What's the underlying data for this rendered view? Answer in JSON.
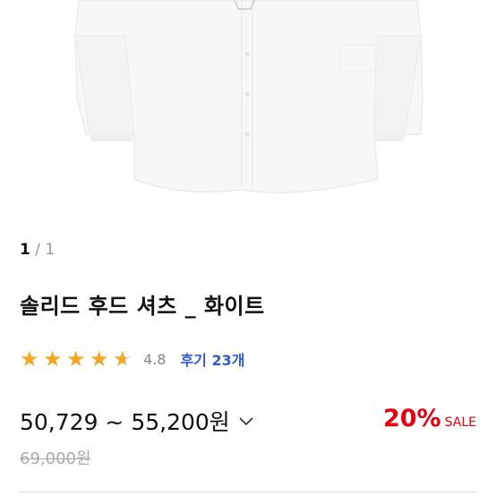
{
  "pager": {
    "current": "1",
    "separator": "/",
    "total": "1"
  },
  "product": {
    "title": "솔리드 후드 셔츠 _ 화이트",
    "rating": {
      "stars": 4.8,
      "score_text": "4.8"
    },
    "reviews_label": "후기 23개",
    "price_range": "50,729 ~ 55,200원",
    "original_price": "69,000원",
    "discount": {
      "percent": "20%",
      "label": "SALE"
    }
  },
  "icons": {
    "image": "white-shirt-image",
    "star": "star-icon",
    "chevron": "chevron-down-icon"
  },
  "colors": {
    "star": "#f5a623",
    "review_link": "#2f5bd3",
    "discount": "#e60012",
    "muted": "#aaaaaa"
  }
}
